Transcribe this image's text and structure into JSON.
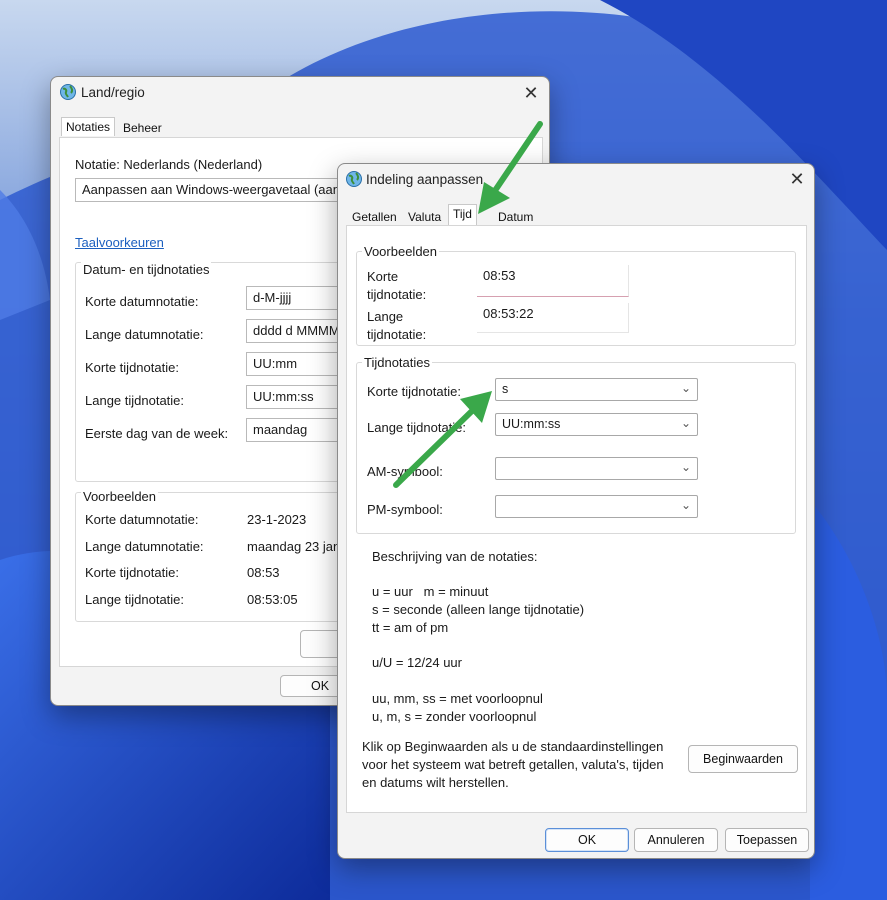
{
  "back_window": {
    "title": "Land/regio",
    "tabs": [
      "Notaties",
      "Beheer"
    ],
    "notation_label": "Notatie: Nederlands (Nederland)",
    "notation_select": "Aanpassen aan Windows-weergavetaal (aanb",
    "link": "Taalvoorkeuren",
    "formats_header": "Datum- en tijdnotaties",
    "formats": [
      {
        "label": "Korte datumnotatie:",
        "value": "d-M-jjjj"
      },
      {
        "label": "Lange datumnotatie:",
        "value": "dddd d MMMM"
      },
      {
        "label": "Korte tijdnotatie:",
        "value": "UU:mm"
      },
      {
        "label": "Lange tijdnotatie:",
        "value": "UU:mm:ss"
      },
      {
        "label": "Eerste dag van de week:",
        "value": "maandag"
      }
    ],
    "examples_header": "Voorbeelden",
    "examples": [
      {
        "label": "Korte datumnotatie:",
        "value": "23-1-2023"
      },
      {
        "label": "Lange datumnotatie:",
        "value": "maandag 23 jan"
      },
      {
        "label": "Korte tijdnotatie:",
        "value": "08:53"
      },
      {
        "label": "Lange tijdnotatie:",
        "value": "08:53:05"
      }
    ],
    "ok_label": "OK"
  },
  "front_window": {
    "title": "Indeling aanpassen",
    "tabs": [
      "Getallen",
      "Valuta",
      "Tijd",
      "Datum"
    ],
    "examples_header": "Voorbeelden",
    "examples": [
      {
        "label_line1": "Korte",
        "label_line2": "tijdnotatie:",
        "value": "08:53"
      },
      {
        "label_line1": "Lange",
        "label_line2": "tijdnotatie:",
        "value": "08:53:22"
      }
    ],
    "formats_header": "Tijdnotaties",
    "fields": [
      {
        "label": "Korte tijdnotatie:",
        "value": "s"
      },
      {
        "label": "Lange tijdnotatie:",
        "value": "UU:mm:ss"
      },
      {
        "label": "AM-symbool:",
        "value": ""
      },
      {
        "label": "PM-symbool:",
        "value": ""
      }
    ],
    "description": {
      "header": "Beschrijving van de notaties:",
      "lines": [
        "u = uur   m = minuut",
        "s = seconde (alleen lange tijdnotatie)",
        "tt = am of pm",
        "u/U = 12/24 uur",
        "uu, mm, ss = met voorloopnul",
        "u, m, s = zonder voorloopnul"
      ]
    },
    "reset_text": [
      "Klik op Beginwaarden als u de standaardinstellingen",
      "voor het systeem wat betreft getallen, valuta's, tijden",
      "en datums wilt herstellen."
    ],
    "reset_button": "Beginwaarden",
    "buttons": {
      "ok": "OK",
      "cancel": "Annuleren",
      "apply": "Toepassen"
    }
  },
  "colors": {
    "arrow": "#3aa84a",
    "link": "#1b5fbf",
    "accent_border": "#5b8fd8"
  }
}
